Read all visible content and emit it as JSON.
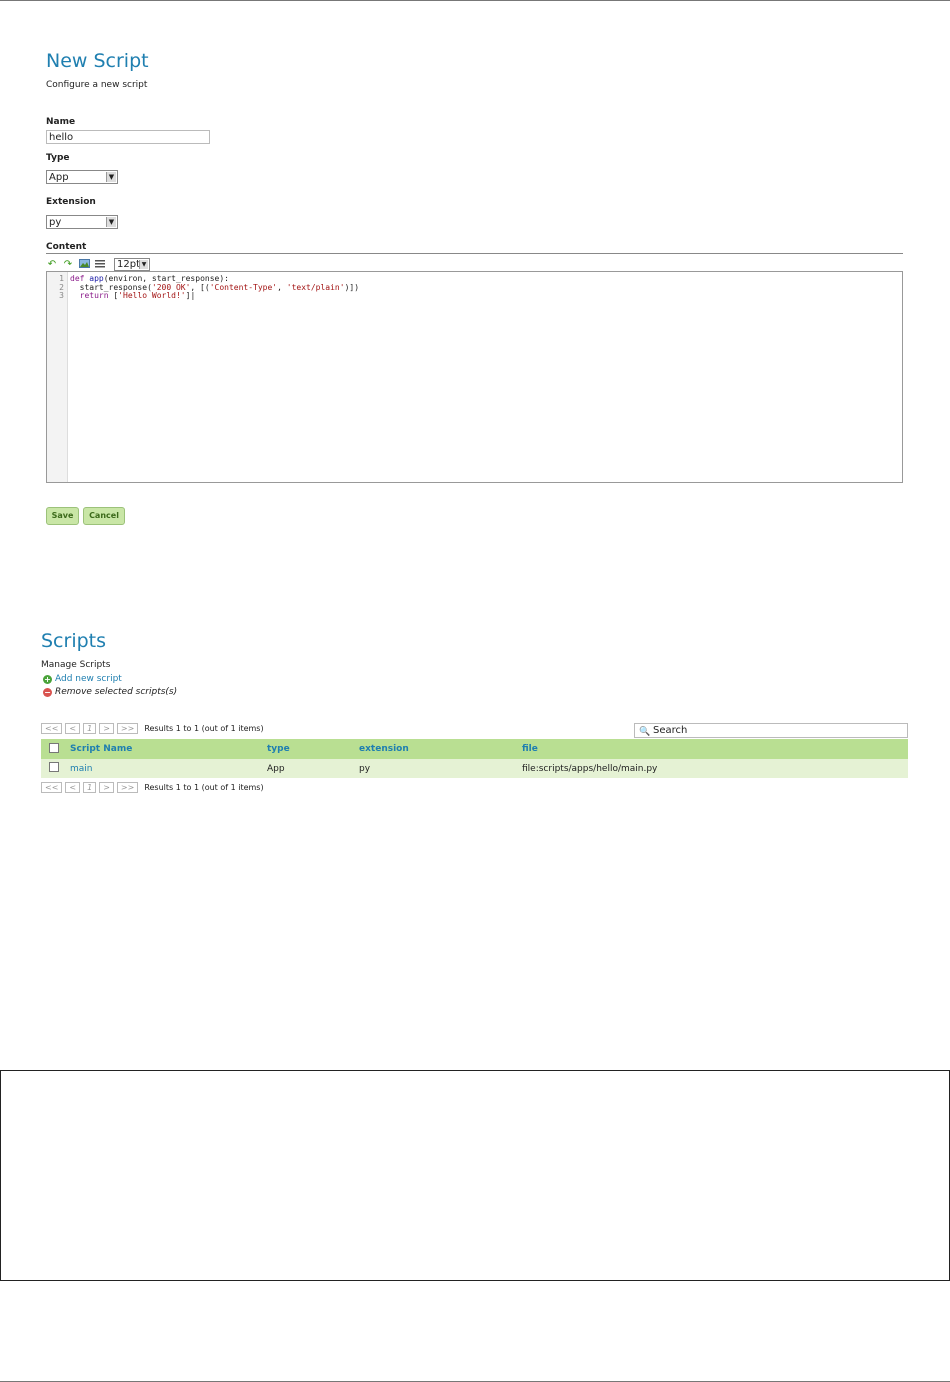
{
  "new_script": {
    "title": "New Script",
    "subtitle": "Configure a new script",
    "name_label": "Name",
    "name_value": "hello",
    "type_label": "Type",
    "type_value": "App",
    "extension_label": "Extension",
    "extension_value": "py",
    "content_label": "Content",
    "font_size_value": "12pt",
    "line_numbers": [
      "1",
      "2",
      "3"
    ],
    "save_label": "Save",
    "cancel_label": "Cancel"
  },
  "scripts": {
    "title": "Scripts",
    "subtitle": "Manage Scripts",
    "add_label": "Add new script",
    "remove_label": "Remove selected scripts(s)",
    "pager": {
      "first": "<<",
      "prev": "<",
      "page": "1",
      "next": ">",
      "last": ">>"
    },
    "results_text": "Results 1 to 1 (out of 1 items)",
    "search_placeholder": "Search",
    "columns": [
      "Script Name",
      "type",
      "extension",
      "file"
    ],
    "rows": [
      {
        "name": "main",
        "type": "App",
        "extension": "py",
        "file": "file:scripts/apps/hello/main.py"
      }
    ]
  },
  "colors": {
    "title_blue": "#1f7fb0",
    "header_green": "#b9df92",
    "row_green": "#e5f2d4",
    "button_green": "#c9e6a6"
  },
  "icons": [
    "undo-icon",
    "redo-icon",
    "image-icon",
    "list-icon",
    "add-icon",
    "remove-icon",
    "search-icon"
  ]
}
